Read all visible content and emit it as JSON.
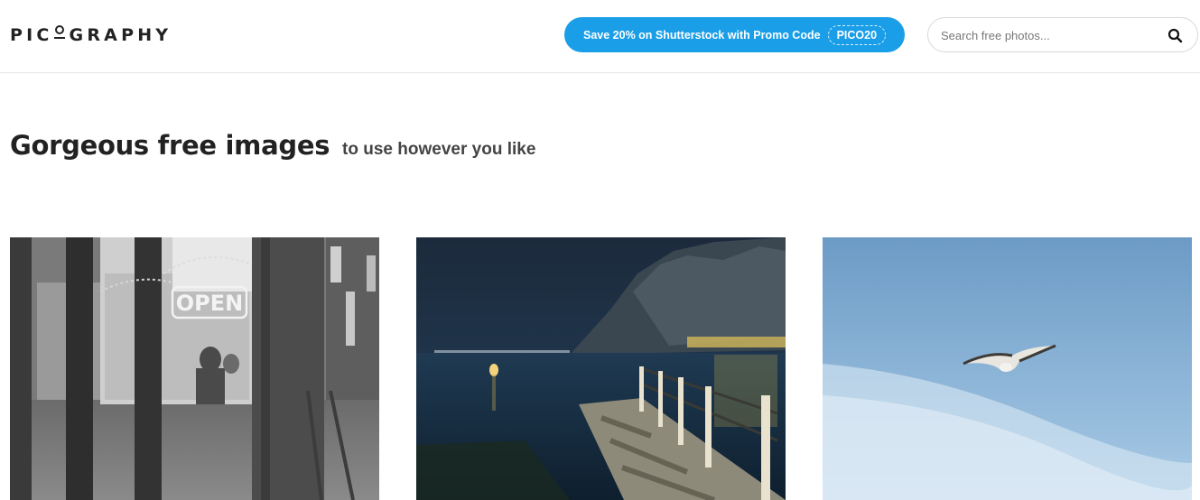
{
  "header": {
    "logo_text": "PICOGRAPHY",
    "promo": {
      "label": "Save 20% on Shutterstock with Promo Code",
      "code": "PICO20",
      "color": "#1a9ee8"
    },
    "search": {
      "placeholder": "Search free photos...",
      "icon": "search-icon"
    }
  },
  "main": {
    "headline": "Gorgeous free images",
    "subheadline": "to use however you like",
    "photos": [
      {
        "subject": "black and white cafe storefront with OPEN sign",
        "sign_text": "OPEN"
      },
      {
        "subject": "wooden pier on lake at night with mountains"
      },
      {
        "subject": "seagull flying in blue sky"
      }
    ]
  }
}
